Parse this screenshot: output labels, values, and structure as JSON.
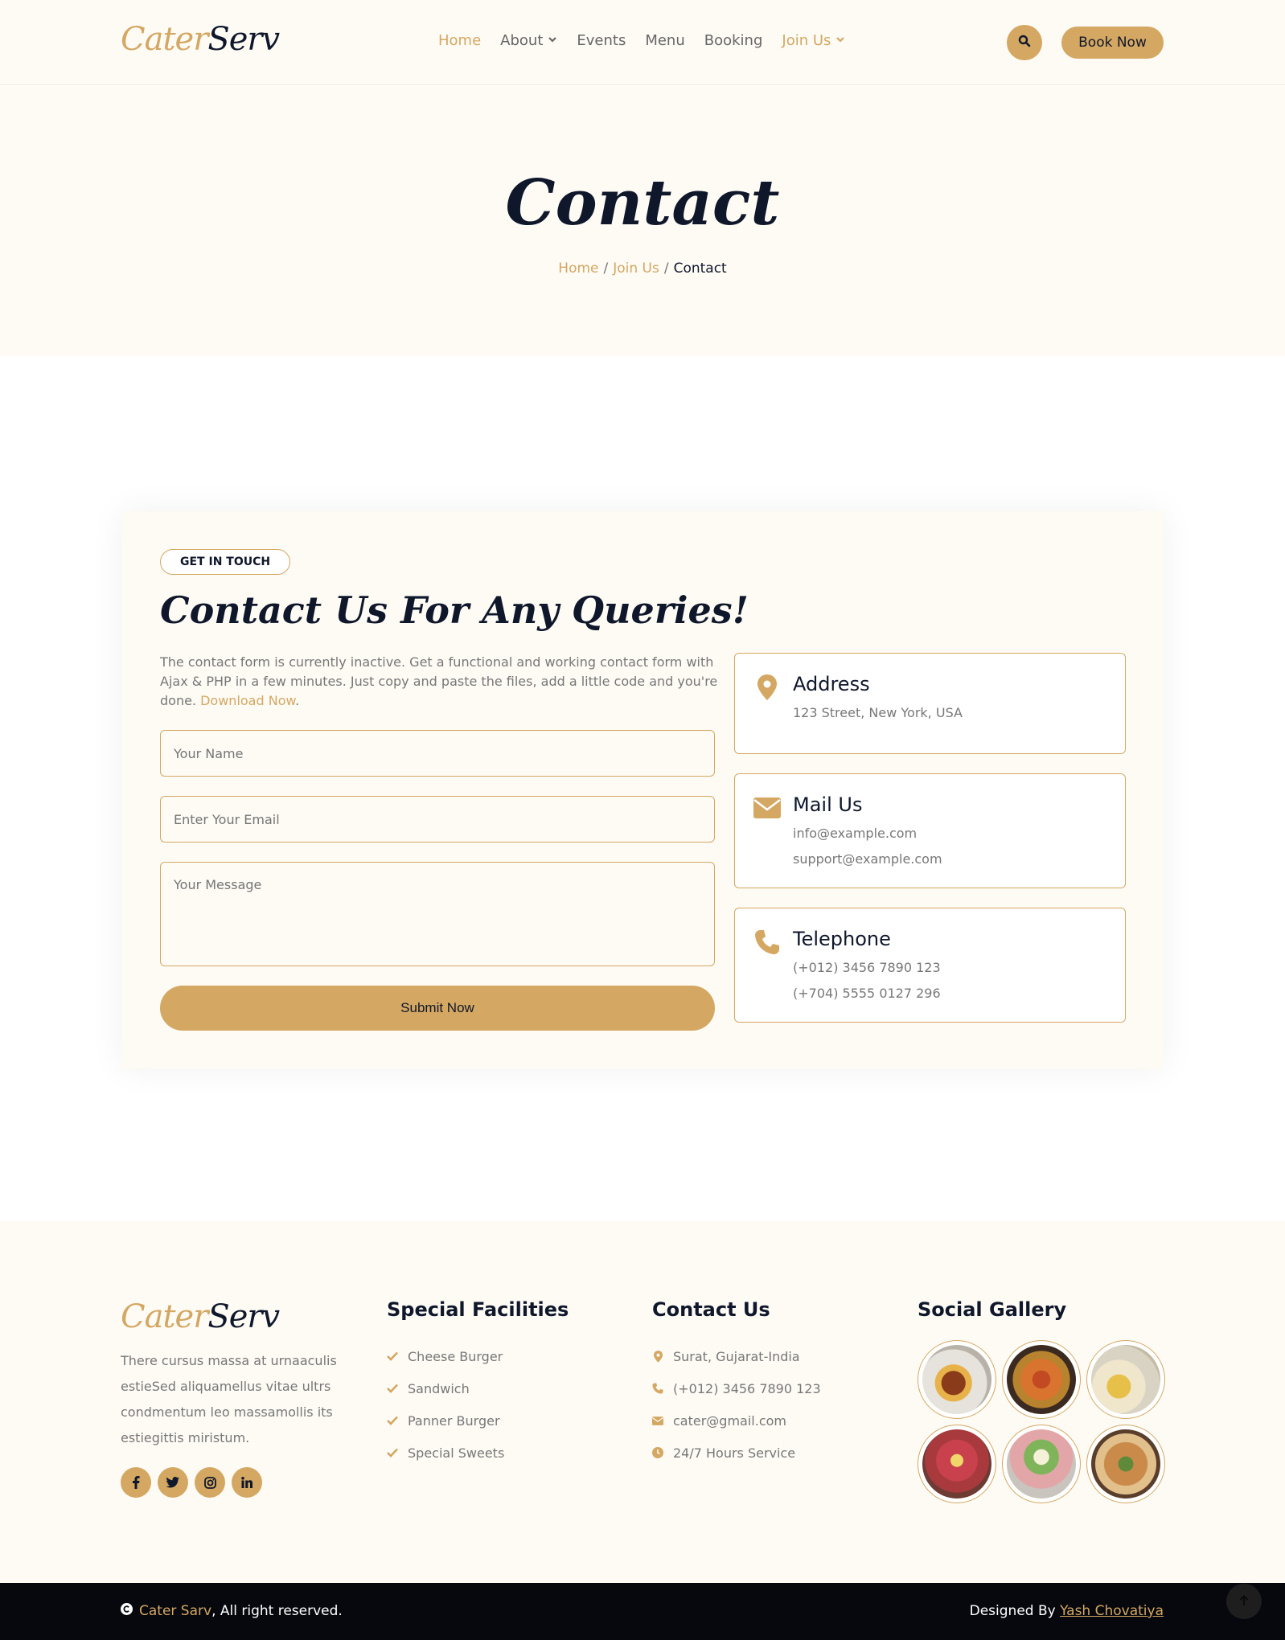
{
  "brand": {
    "logo_part1": "Cater",
    "logo_part2": "Serv"
  },
  "nav": {
    "items": [
      {
        "label": "Home",
        "active": true,
        "dropdown": false
      },
      {
        "label": "About",
        "active": false,
        "dropdown": true
      },
      {
        "label": "Events",
        "active": false,
        "dropdown": false
      },
      {
        "label": "Menu",
        "active": false,
        "dropdown": false
      },
      {
        "label": "Booking",
        "active": false,
        "dropdown": false
      },
      {
        "label": "Join Us",
        "active": true,
        "dropdown": true
      }
    ],
    "book_label": "Book Now"
  },
  "hero": {
    "title": "Contact",
    "breadcrumb": [
      "Home",
      "Join Us",
      "Contact"
    ]
  },
  "contact": {
    "badge": "GET IN TOUCH",
    "title": "Contact Us For Any Queries!",
    "text": "The contact form is currently inactive. Get a functional and working contact form with Ajax & PHP in a few minutes. Just copy and paste the files, add a little code and you're done.",
    "link": "Download Now",
    "name_placeholder": "Your Name",
    "email_placeholder": "Enter Your Email",
    "message_placeholder": "Your Message",
    "submit_label": "Submit Now",
    "address": {
      "title": "Address",
      "line1": "123 Street, New York, USA"
    },
    "mail": {
      "title": "Mail Us",
      "line1": "info@example.com",
      "line2": "support@example.com"
    },
    "phone": {
      "title": "Telephone",
      "line1": "(+012) 3456 7890 123",
      "line2": "(+704) 5555 0127 296"
    }
  },
  "footer": {
    "about": "There cursus massa at urnaaculis estieSed aliquamellus vitae ultrs condmentum leo massamollis its estiegittis miristum.",
    "facilities": {
      "title": "Special Facilities",
      "items": [
        "Cheese Burger",
        "Sandwich",
        "Panner Burger",
        "Special Sweets"
      ]
    },
    "contact": {
      "title": "Contact Us",
      "items": [
        "Surat, Gujarat-India",
        "(+012) 3456 7890 123",
        "cater@gmail.com",
        "24/7 Hours Service"
      ]
    },
    "gallery": {
      "title": "Social Gallery"
    }
  },
  "bottom": {
    "copy_brand": "Cater Sarv",
    "copy_rest": ", All right reserved.",
    "designed_prefix": "Designed By ",
    "designer": "Yash Chovatiya"
  },
  "colors": {
    "accent": "#d4a762",
    "dark": "#0f172b",
    "light_bg": "#fefbf5"
  }
}
